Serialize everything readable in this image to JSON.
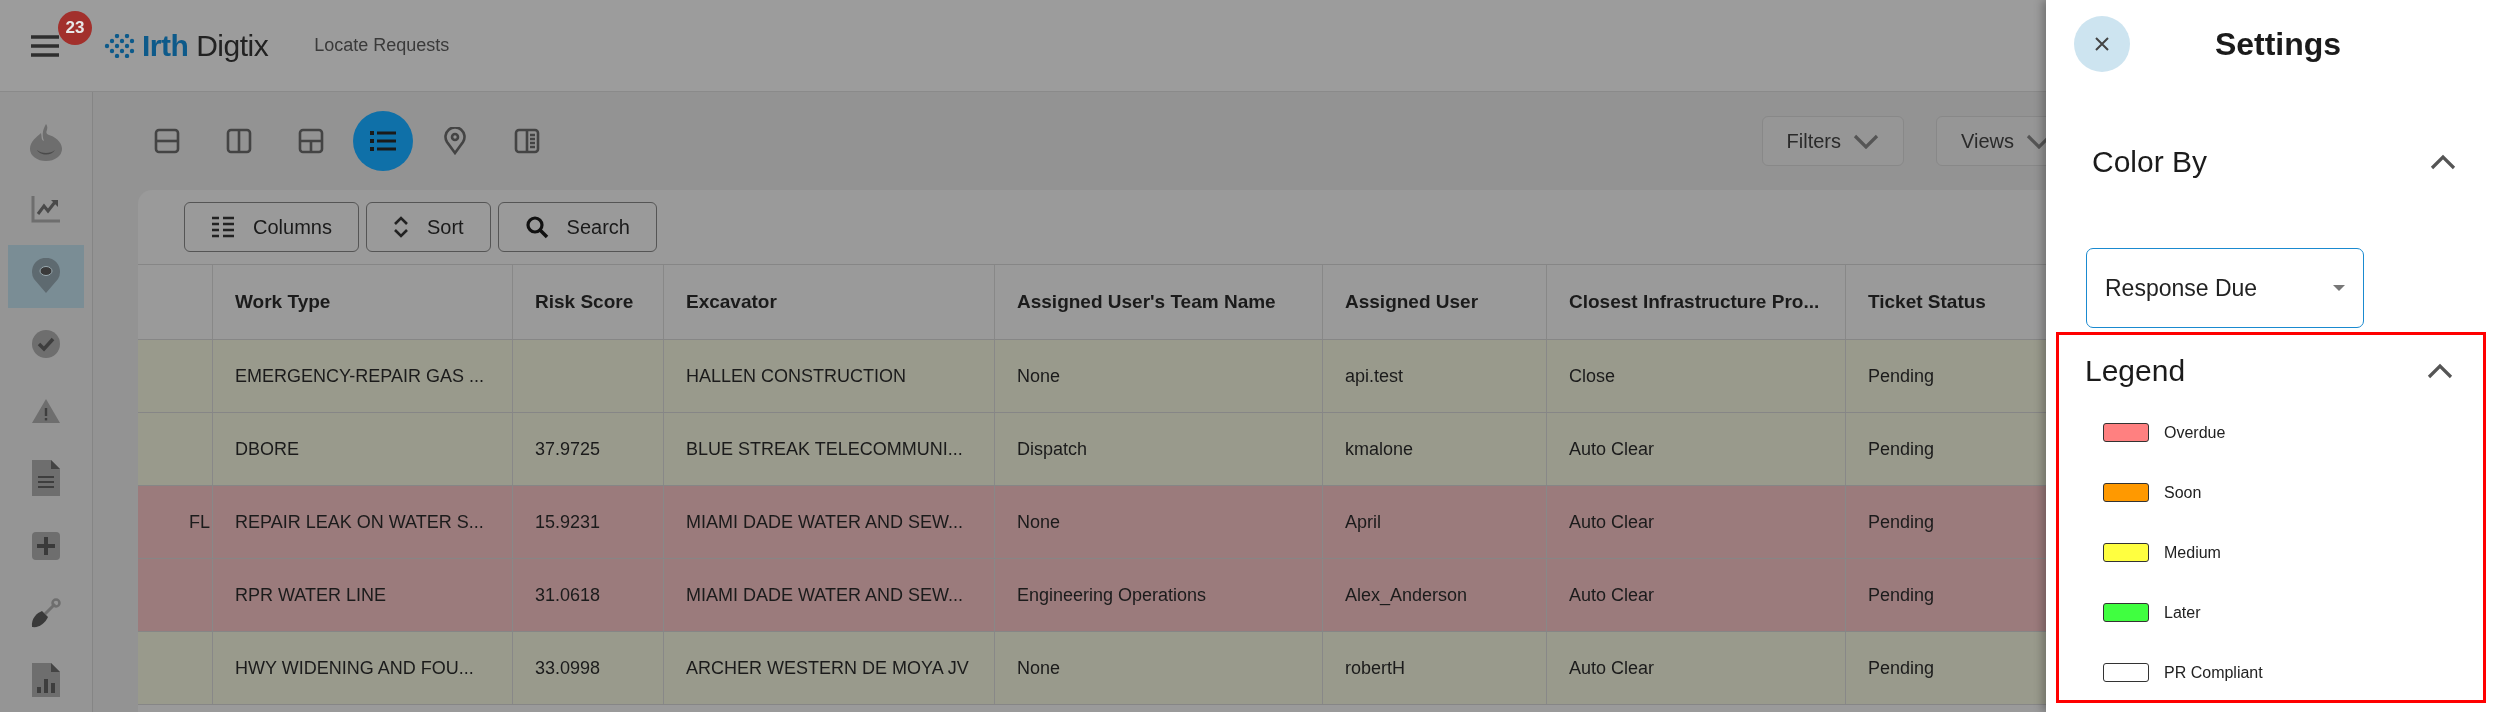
{
  "header": {
    "notification_count": "23",
    "logo": {
      "first": "Irth",
      "second": "Digtix"
    },
    "page_title": "Locate Requests"
  },
  "sidebar": {
    "items": [
      {
        "kind": "flame",
        "selected": false
      },
      {
        "kind": "chart",
        "selected": false
      },
      {
        "kind": "pin",
        "selected": true
      },
      {
        "kind": "check",
        "selected": false
      },
      {
        "kind": "warning",
        "selected": false
      },
      {
        "kind": "document",
        "selected": false
      },
      {
        "kind": "plus",
        "selected": false
      },
      {
        "kind": "shovel",
        "selected": false
      },
      {
        "kind": "report",
        "selected": false
      }
    ]
  },
  "view_toolbar": {
    "items": [
      {
        "kind": "rows",
        "selected": false
      },
      {
        "kind": "columns",
        "selected": false
      },
      {
        "kind": "grid",
        "selected": false
      },
      {
        "kind": "list",
        "selected": true
      },
      {
        "kind": "pin",
        "selected": false
      },
      {
        "kind": "panel",
        "selected": false
      }
    ],
    "buttons": [
      "Filters",
      "Views"
    ]
  },
  "table_toolbar": {
    "buttons": [
      {
        "kind": "columns",
        "label": "Columns"
      },
      {
        "kind": "sort",
        "label": "Sort"
      },
      {
        "kind": "search",
        "label": "Search"
      }
    ]
  },
  "table": {
    "columns": [
      "Work Type",
      "Risk Score",
      "Excavator",
      "Assigned User's Team Name",
      "Assigned User",
      "Closest Infrastructure Pro...",
      "Ticket Status"
    ],
    "rows": [
      {
        "color": "#999a8c",
        "cells": [
          "EMERGENCY-REPAIR GAS ...",
          null,
          "HALLEN CONSTRUCTION",
          "None",
          "api.test",
          "Close",
          "Pending"
        ]
      },
      {
        "color": "#999a8c",
        "cells": [
          "DBORE",
          "37.9725",
          "BLUE STREAK TELECOMMUNI...",
          "Dispatch",
          "kmalone",
          "Auto Clear",
          "Pending"
        ]
      },
      {
        "color": "#9b7b7c",
        "column_1": "FL",
        "cells": [
          "REPAIR LEAK ON WATER S...",
          "15.9231",
          "MIAMI DADE WATER AND SEW...",
          "None",
          "April",
          "Auto Clear",
          "Pending"
        ]
      },
      {
        "color": "#9b7b7c",
        "cells": [
          "RPR WATER LINE",
          "31.0618",
          "MIAMI DADE WATER AND SEW...",
          "Engineering Operations",
          "Alex_Anderson",
          "Auto Clear",
          "Pending"
        ]
      },
      {
        "color": "#999a8c",
        "cells": [
          "HWY WIDENING AND FOU...",
          "33.0998",
          "ARCHER WESTERN DE MOYA JV",
          "None",
          "robertH",
          "Auto Clear",
          "Pending"
        ]
      }
    ]
  },
  "settings": {
    "title": "Settings",
    "color_by": {
      "title": "Color By",
      "expanded": true,
      "value": "Response Due"
    },
    "legend": {
      "title": "Legend",
      "expanded": true,
      "highlighted": true,
      "items": [
        {
          "label": "Overdue",
          "color": "#ff8080"
        },
        {
          "label": "Soon",
          "color": "#ff9900"
        },
        {
          "label": "Medium",
          "color": "#ffff40"
        },
        {
          "label": "Later",
          "color": "#40ff40"
        },
        {
          "label": "PR Compliant",
          "color": "#ffffff"
        }
      ]
    }
  }
}
